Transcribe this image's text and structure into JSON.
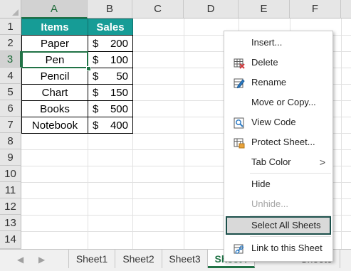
{
  "columns": [
    "A",
    "B",
    "C",
    "D",
    "E",
    "F"
  ],
  "rows": [
    "1",
    "2",
    "3",
    "4",
    "5",
    "6",
    "7",
    "8",
    "9",
    "10",
    "11",
    "12",
    "13",
    "14"
  ],
  "table": {
    "headers": [
      "Items",
      "Sales"
    ],
    "currency": "$",
    "rows": [
      {
        "item": "Paper",
        "value": "200"
      },
      {
        "item": "Pen",
        "value": "100"
      },
      {
        "item": "Pencil",
        "value": "50"
      },
      {
        "item": "Chart",
        "value": "150"
      },
      {
        "item": "Books",
        "value": "500"
      },
      {
        "item": "Notebook",
        "value": "400"
      }
    ]
  },
  "context_menu": {
    "items": [
      {
        "label": "Insert...",
        "icon": "",
        "disabled": false
      },
      {
        "label": "Delete",
        "icon": "delete-sheet-icon",
        "disabled": false
      },
      {
        "label": "Rename",
        "icon": "rename-icon",
        "disabled": false
      },
      {
        "label": "Move or Copy...",
        "icon": "",
        "disabled": false
      },
      {
        "label": "View Code",
        "icon": "view-code-icon",
        "disabled": false
      },
      {
        "label": "Protect Sheet...",
        "icon": "protect-sheet-icon",
        "disabled": false
      },
      {
        "label": "Tab Color",
        "icon": "",
        "disabled": false,
        "submenu": true
      },
      {
        "label": "Hide",
        "icon": "",
        "disabled": false
      },
      {
        "label": "Unhide...",
        "icon": "",
        "disabled": true
      },
      {
        "label": "Select All Sheets",
        "icon": "",
        "disabled": false,
        "selected": true
      },
      {
        "label": "Link to this Sheet",
        "icon": "link-icon",
        "disabled": false
      }
    ],
    "submenu_arrow": ">"
  },
  "tabs": {
    "nav_prev": "◀",
    "nav_next": "▶",
    "sheets": [
      "Sheet1",
      "Sheet2",
      "Sheet3",
      "Sheet4",
      "Sheet6"
    ],
    "active": "Sheet4"
  },
  "colors": {
    "header_fill": "#169c96",
    "excel_green": "#217346",
    "menu_highlight_border": "#1b4f4a"
  }
}
